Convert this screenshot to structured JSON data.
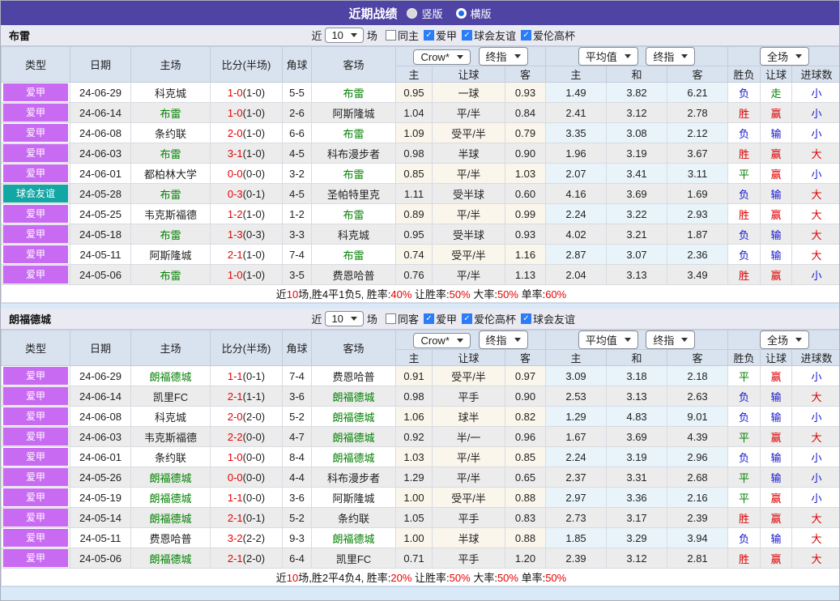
{
  "titlebar": {
    "title": "近期战绩",
    "radios": [
      {
        "label": "竖版",
        "selected": false
      },
      {
        "label": "横版",
        "selected": true
      }
    ]
  },
  "table_header": {
    "type": "类型",
    "date": "日期",
    "home": "主场",
    "score": "比分(半场)",
    "corner": "角球",
    "away": "客场",
    "dd_provider": "Crow*",
    "dd_final1": "终指",
    "dd_avg": "平均值",
    "dd_final2": "终指",
    "dd_scope": "全场",
    "odds_cols": {
      "home": "主",
      "handicap": "让球",
      "away": "客"
    },
    "avg_cols": {
      "home": "主",
      "draw": "和",
      "away": "客"
    },
    "result_cols": {
      "result": "胜负",
      "handicap": "让球",
      "goals": "进球数"
    }
  },
  "colors": {
    "league": "#c86af2",
    "friendly": "#12a7a5",
    "team_green": "#008000",
    "score_red": "#e60000",
    "summary_red": "#e60000",
    "titlebar_purple": "#4f43a3"
  },
  "result_colors": {
    "胜": "#dd0000",
    "平": "#008000",
    "负": "#1515cc",
    "赢": "#dd0000",
    "走": "#008000",
    "输": "#1515cc",
    "大": "#dd0000",
    "小": "#1515cc"
  },
  "sections": [
    {
      "team": "布雷",
      "filter": {
        "prefix": "近",
        "count": "10",
        "suffix": "场",
        "checkboxes": [
          {
            "label": "同主",
            "checked": false
          },
          {
            "label": "爱甲",
            "checked": true
          },
          {
            "label": "球会友谊",
            "checked": true
          },
          {
            "label": "爱伦高杯",
            "checked": true
          }
        ]
      },
      "rows": [
        {
          "type": "爱甲",
          "badge": "league",
          "date": "24-06-29",
          "home": "科克城",
          "home_hl": false,
          "ft": "1-0",
          "ht": "(1-0)",
          "corner": "5-5",
          "away": "布雷",
          "away_hl": true,
          "o1": "0.95",
          "hc": "一球",
          "o2": "0.93",
          "a1": "1.49",
          "a2": "3.82",
          "a3": "6.21",
          "r": "负",
          "rh": "走",
          "rg": "小"
        },
        {
          "type": "爱甲",
          "badge": "league",
          "date": "24-06-14",
          "home": "布雷",
          "home_hl": true,
          "ft": "1-0",
          "ht": "(1-0)",
          "corner": "2-6",
          "away": "阿斯隆城",
          "away_hl": false,
          "o1": "1.04",
          "hc": "平/半",
          "o2": "0.84",
          "a1": "2.41",
          "a2": "3.12",
          "a3": "2.78",
          "r": "胜",
          "rh": "赢",
          "rg": "小"
        },
        {
          "type": "爱甲",
          "badge": "league",
          "date": "24-06-08",
          "home": "条约联",
          "home_hl": false,
          "ft": "2-0",
          "ht": "(1-0)",
          "corner": "6-6",
          "away": "布雷",
          "away_hl": true,
          "o1": "1.09",
          "hc": "受平/半",
          "o2": "0.79",
          "a1": "3.35",
          "a2": "3.08",
          "a3": "2.12",
          "r": "负",
          "rh": "输",
          "rg": "小"
        },
        {
          "type": "爱甲",
          "badge": "league",
          "date": "24-06-03",
          "home": "布雷",
          "home_hl": true,
          "ft": "3-1",
          "ht": "(1-0)",
          "corner": "4-5",
          "away": "科布漫步者",
          "away_hl": false,
          "o1": "0.98",
          "hc": "半球",
          "o2": "0.90",
          "a1": "1.96",
          "a2": "3.19",
          "a3": "3.67",
          "r": "胜",
          "rh": "赢",
          "rg": "大"
        },
        {
          "type": "爱甲",
          "badge": "league",
          "date": "24-06-01",
          "home": "都柏林大学",
          "home_hl": false,
          "ft": "0-0",
          "ht": "(0-0)",
          "corner": "3-2",
          "away": "布雷",
          "away_hl": true,
          "o1": "0.85",
          "hc": "平/半",
          "o2": "1.03",
          "a1": "2.07",
          "a2": "3.41",
          "a3": "3.11",
          "r": "平",
          "rh": "赢",
          "rg": "小"
        },
        {
          "type": "球会友谊",
          "badge": "friendly",
          "date": "24-05-28",
          "home": "布雷",
          "home_hl": true,
          "ft": "0-3",
          "ht": "(0-1)",
          "corner": "4-5",
          "away": "圣帕特里克",
          "away_hl": false,
          "o1": "1.11",
          "hc": "受半球",
          "o2": "0.60",
          "a1": "4.16",
          "a2": "3.69",
          "a3": "1.69",
          "r": "负",
          "rh": "输",
          "rg": "大"
        },
        {
          "type": "爱甲",
          "badge": "league",
          "date": "24-05-25",
          "home": "韦克斯福德",
          "home_hl": false,
          "ft": "1-2",
          "ht": "(1-0)",
          "corner": "1-2",
          "away": "布雷",
          "away_hl": true,
          "o1": "0.89",
          "hc": "平/半",
          "o2": "0.99",
          "a1": "2.24",
          "a2": "3.22",
          "a3": "2.93",
          "r": "胜",
          "rh": "赢",
          "rg": "大"
        },
        {
          "type": "爱甲",
          "badge": "league",
          "date": "24-05-18",
          "home": "布雷",
          "home_hl": true,
          "ft": "1-3",
          "ht": "(0-3)",
          "corner": "3-3",
          "away": "科克城",
          "away_hl": false,
          "o1": "0.95",
          "hc": "受半球",
          "o2": "0.93",
          "a1": "4.02",
          "a2": "3.21",
          "a3": "1.87",
          "r": "负",
          "rh": "输",
          "rg": "大"
        },
        {
          "type": "爱甲",
          "badge": "league",
          "date": "24-05-11",
          "home": "阿斯隆城",
          "home_hl": false,
          "ft": "2-1",
          "ht": "(1-0)",
          "corner": "7-4",
          "away": "布雷",
          "away_hl": true,
          "o1": "0.74",
          "hc": "受平/半",
          "o2": "1.16",
          "a1": "2.87",
          "a2": "3.07",
          "a3": "2.36",
          "r": "负",
          "rh": "输",
          "rg": "大"
        },
        {
          "type": "爱甲",
          "badge": "league",
          "date": "24-05-06",
          "home": "布雷",
          "home_hl": true,
          "ft": "1-0",
          "ht": "(1-0)",
          "corner": "3-5",
          "away": "费恩哈普",
          "away_hl": false,
          "o1": "0.76",
          "hc": "平/半",
          "o2": "1.13",
          "a1": "2.04",
          "a2": "3.13",
          "a3": "3.49",
          "r": "胜",
          "rh": "赢",
          "rg": "小"
        }
      ],
      "summary": [
        [
          "近",
          0
        ],
        [
          "10",
          1
        ],
        [
          "场,胜4平1负5, 胜率:",
          0
        ],
        [
          "40%",
          1
        ],
        [
          " 让胜率:",
          0
        ],
        [
          "50%",
          1
        ],
        [
          " 大率:",
          0
        ],
        [
          "50%",
          1
        ],
        [
          " 单率:",
          0
        ],
        [
          "60%",
          1
        ]
      ]
    },
    {
      "team": "朗福德城",
      "filter": {
        "prefix": "近",
        "count": "10",
        "suffix": "场",
        "checkboxes": [
          {
            "label": "同客",
            "checked": false
          },
          {
            "label": "爱甲",
            "checked": true
          },
          {
            "label": "爱伦高杯",
            "checked": true
          },
          {
            "label": "球会友谊",
            "checked": true
          }
        ]
      },
      "rows": [
        {
          "type": "爱甲",
          "badge": "league",
          "date": "24-06-29",
          "home": "朗福德城",
          "home_hl": true,
          "ft": "1-1",
          "ht": "(0-1)",
          "corner": "7-4",
          "away": "费恩哈普",
          "away_hl": false,
          "o1": "0.91",
          "hc": "受平/半",
          "o2": "0.97",
          "a1": "3.09",
          "a2": "3.18",
          "a3": "2.18",
          "r": "平",
          "rh": "赢",
          "rg": "小"
        },
        {
          "type": "爱甲",
          "badge": "league",
          "date": "24-06-14",
          "home": "凯里FC",
          "home_hl": false,
          "ft": "2-1",
          "ht": "(1-1)",
          "corner": "3-6",
          "away": "朗福德城",
          "away_hl": true,
          "o1": "0.98",
          "hc": "平手",
          "o2": "0.90",
          "a1": "2.53",
          "a2": "3.13",
          "a3": "2.63",
          "r": "负",
          "rh": "输",
          "rg": "大"
        },
        {
          "type": "爱甲",
          "badge": "league",
          "date": "24-06-08",
          "home": "科克城",
          "home_hl": false,
          "ft": "2-0",
          "ht": "(2-0)",
          "corner": "5-2",
          "away": "朗福德城",
          "away_hl": true,
          "o1": "1.06",
          "hc": "球半",
          "o2": "0.82",
          "a1": "1.29",
          "a2": "4.83",
          "a3": "9.01",
          "r": "负",
          "rh": "输",
          "rg": "小"
        },
        {
          "type": "爱甲",
          "badge": "league",
          "date": "24-06-03",
          "home": "韦克斯福德",
          "home_hl": false,
          "ft": "2-2",
          "ht": "(0-0)",
          "corner": "4-7",
          "away": "朗福德城",
          "away_hl": true,
          "o1": "0.92",
          "hc": "半/一",
          "o2": "0.96",
          "a1": "1.67",
          "a2": "3.69",
          "a3": "4.39",
          "r": "平",
          "rh": "赢",
          "rg": "大"
        },
        {
          "type": "爱甲",
          "badge": "league",
          "date": "24-06-01",
          "home": "条约联",
          "home_hl": false,
          "ft": "1-0",
          "ht": "(0-0)",
          "corner": "8-4",
          "away": "朗福德城",
          "away_hl": true,
          "o1": "1.03",
          "hc": "平/半",
          "o2": "0.85",
          "a1": "2.24",
          "a2": "3.19",
          "a3": "2.96",
          "r": "负",
          "rh": "输",
          "rg": "小"
        },
        {
          "type": "爱甲",
          "badge": "league",
          "date": "24-05-26",
          "home": "朗福德城",
          "home_hl": true,
          "ft": "0-0",
          "ht": "(0-0)",
          "corner": "4-4",
          "away": "科布漫步者",
          "away_hl": false,
          "o1": "1.29",
          "hc": "平/半",
          "o2": "0.65",
          "a1": "2.37",
          "a2": "3.31",
          "a3": "2.68",
          "r": "平",
          "rh": "输",
          "rg": "小"
        },
        {
          "type": "爱甲",
          "badge": "league",
          "date": "24-05-19",
          "home": "朗福德城",
          "home_hl": true,
          "ft": "1-1",
          "ht": "(0-0)",
          "corner": "3-6",
          "away": "阿斯隆城",
          "away_hl": false,
          "o1": "1.00",
          "hc": "受平/半",
          "o2": "0.88",
          "a1": "2.97",
          "a2": "3.36",
          "a3": "2.16",
          "r": "平",
          "rh": "赢",
          "rg": "小"
        },
        {
          "type": "爱甲",
          "badge": "league",
          "date": "24-05-14",
          "home": "朗福德城",
          "home_hl": true,
          "ft": "2-1",
          "ht": "(0-1)",
          "corner": "5-2",
          "away": "条约联",
          "away_hl": false,
          "o1": "1.05",
          "hc": "平手",
          "o2": "0.83",
          "a1": "2.73",
          "a2": "3.17",
          "a3": "2.39",
          "r": "胜",
          "rh": "赢",
          "rg": "大"
        },
        {
          "type": "爱甲",
          "badge": "league",
          "date": "24-05-11",
          "home": "费恩哈普",
          "home_hl": false,
          "ft": "3-2",
          "ht": "(2-2)",
          "corner": "9-3",
          "away": "朗福德城",
          "away_hl": true,
          "o1": "1.00",
          "hc": "半球",
          "o2": "0.88",
          "a1": "1.85",
          "a2": "3.29",
          "a3": "3.94",
          "r": "负",
          "rh": "输",
          "rg": "大"
        },
        {
          "type": "爱甲",
          "badge": "league",
          "date": "24-05-06",
          "home": "朗福德城",
          "home_hl": true,
          "ft": "2-1",
          "ht": "(2-0)",
          "corner": "6-4",
          "away": "凯里FC",
          "away_hl": false,
          "o1": "0.71",
          "hc": "平手",
          "o2": "1.20",
          "a1": "2.39",
          "a2": "3.12",
          "a3": "2.81",
          "r": "胜",
          "rh": "赢",
          "rg": "大"
        }
      ],
      "summary": [
        [
          "近",
          0
        ],
        [
          "10",
          1
        ],
        [
          "场,胜2平4负4, 胜率:",
          0
        ],
        [
          "20%",
          1
        ],
        [
          " 让胜率:",
          0
        ],
        [
          "50%",
          1
        ],
        [
          " 大率:",
          0
        ],
        [
          "50%",
          1
        ],
        [
          " 单率:",
          0
        ],
        [
          "50%",
          1
        ]
      ]
    }
  ]
}
